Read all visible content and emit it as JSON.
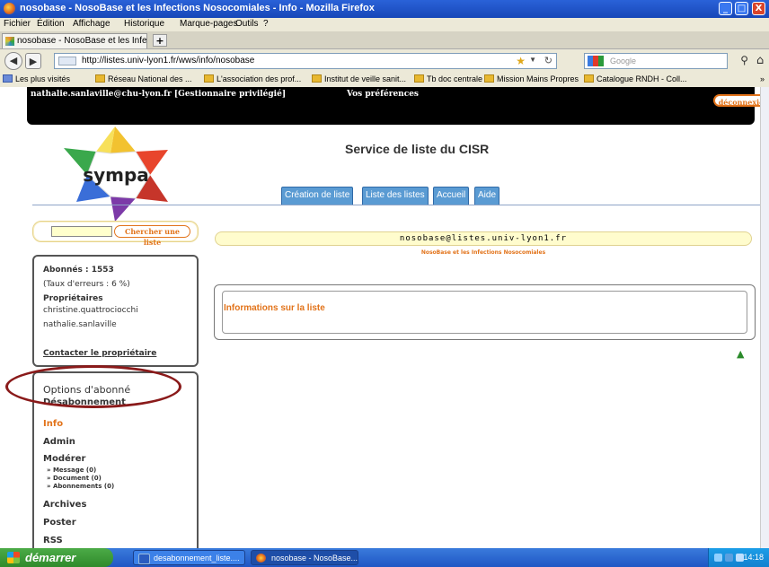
{
  "window": {
    "title": "nosobase - NosoBase et les Infections Nosocomiales - Info - Mozilla Firefox",
    "controls": [
      "_",
      "□",
      "X"
    ]
  },
  "menu": [
    "Fichier",
    "Édition",
    "Affichage",
    "Historique",
    "Marque-pages",
    "Outils",
    "?"
  ],
  "tab": {
    "label": "nosobase - NosoBase et les Infections Noso...",
    "new_tab": "+"
  },
  "nav": {
    "url": "http://listes.univ-lyon1.fr/wws/info/nosobase",
    "search_placeholder": "Google",
    "back": "◀",
    "forward": "▶"
  },
  "bookmarks": [
    "Les plus visités",
    "Réseau National des ...",
    "L'association des prof...",
    "Institut de veille sanit...",
    "Tb doc centrale",
    "Mission Mains Propres",
    "Catalogue RNDH - Coll...",
    "»"
  ],
  "userbar": {
    "user": "nathalie.sanlaville@chu-lyon.fr  [Gestionnaire privilégié]",
    "preferences": "Vos préférences",
    "logout": "déconnexion"
  },
  "header": {
    "service_title": "Service de liste du CISR",
    "logo_text": "sympa",
    "tabs": [
      "Création de liste",
      "Liste des listes",
      "Accueil",
      "Aide"
    ]
  },
  "sidebar": {
    "search_button": "Chercher une liste",
    "info": {
      "subscribers": "Abonnés : 1553",
      "error_rate": "(Taux d'erreurs : 6 %)",
      "owners_label": "Propriétaires",
      "owners": [
        "christine.quattrociocchi",
        "nathalie.sanlaville"
      ],
      "contact": "Contacter le propriétaire"
    },
    "menu": {
      "options": "Options d'abonné",
      "unsubscribe": "Désabonnement",
      "info": "Info",
      "admin": "Admin",
      "moderate": "Modérer",
      "moderate_items": [
        "» Message (0)",
        "» Document (0)",
        "» Abonnements (0)"
      ],
      "archives": "Archives",
      "post": "Poster",
      "rss": "RSS"
    }
  },
  "main": {
    "list_address": "nosobase@listes.univ-lyon1.fr",
    "list_subtitle": "NosoBase et les Infections Nosocomiales",
    "panel_title": "Informations sur la liste"
  },
  "taskbar": {
    "start": "démarrer",
    "tasks": [
      "desabonnement_liste....",
      "nosobase - NosoBase..."
    ],
    "clock": "14:18"
  },
  "colors": {
    "accent_orange": "#e2731a",
    "tab_blue": "#5a9bd3",
    "annotation_oval": "#8a1a1a"
  }
}
